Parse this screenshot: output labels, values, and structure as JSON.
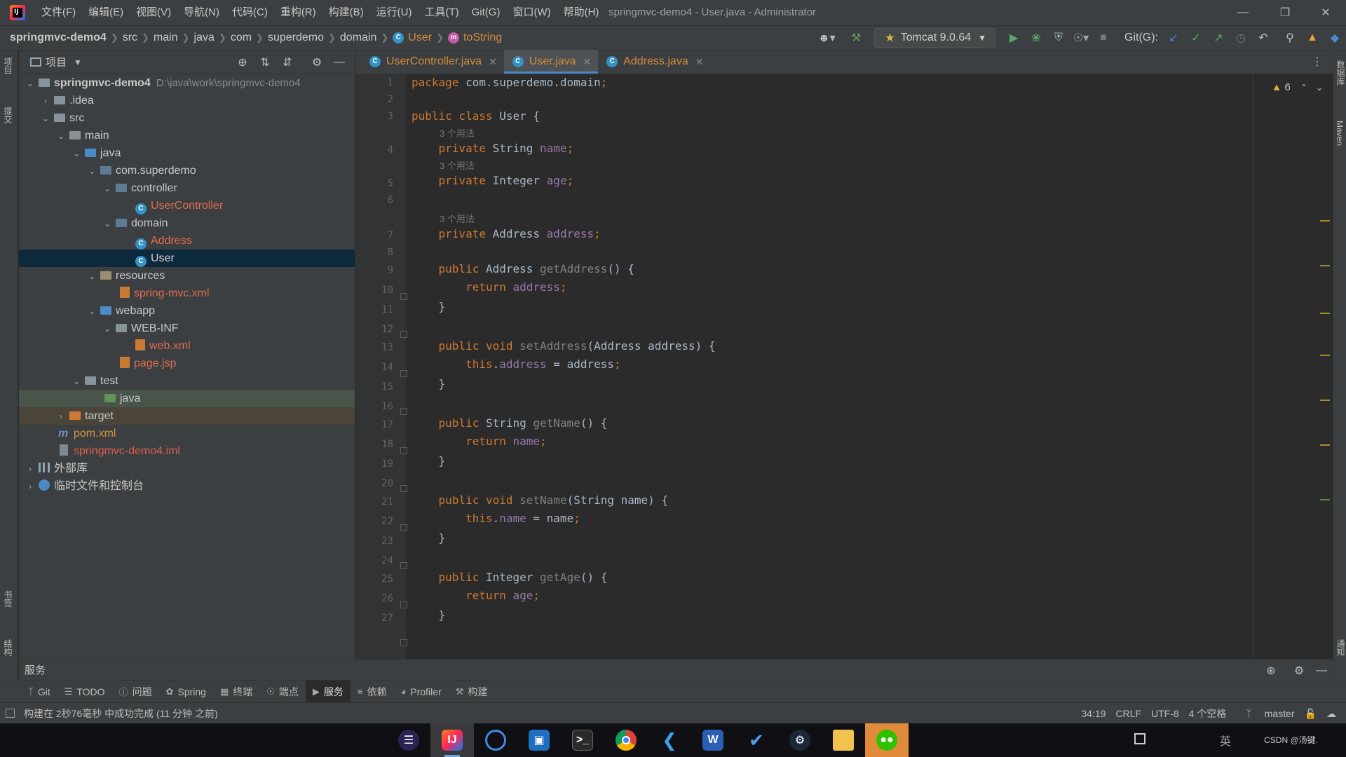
{
  "window": {
    "title": "springmvc-demo4 - User.java - Administrator",
    "menu": [
      "文件(F)",
      "编辑(E)",
      "视图(V)",
      "导航(N)",
      "代码(C)",
      "重构(R)",
      "构建(B)",
      "运行(U)",
      "工具(T)",
      "Git(G)",
      "窗口(W)",
      "帮助(H)"
    ]
  },
  "breadcrumb": [
    "springmvc-demo4",
    "src",
    "main",
    "java",
    "com",
    "superdemo",
    "domain",
    "User",
    "toString"
  ],
  "toolbar": {
    "run_config": "Tomcat 9.0.64",
    "git_label": "Git(G):"
  },
  "left_strip": {
    "top": "项目",
    "mid": "提交",
    "bookmarks": "书签",
    "structure": "结构"
  },
  "right_strip": {
    "db": "数据库",
    "maven": "Maven",
    "notify": "通知"
  },
  "project": {
    "header": "项目",
    "tree": [
      {
        "label": "springmvc-demo4",
        "path": "D:\\java\\work\\springmvc-demo4"
      },
      {
        "label": ".idea"
      },
      {
        "label": "src"
      },
      {
        "label": "main"
      },
      {
        "label": "java"
      },
      {
        "label": "com.superdemo"
      },
      {
        "label": "controller"
      },
      {
        "label": "UserController"
      },
      {
        "label": "domain"
      },
      {
        "label": "Address"
      },
      {
        "label": "User"
      },
      {
        "label": "resources"
      },
      {
        "label": "spring-mvc.xml"
      },
      {
        "label": "webapp"
      },
      {
        "label": "WEB-INF"
      },
      {
        "label": "web.xml"
      },
      {
        "label": "page.jsp"
      },
      {
        "label": "test"
      },
      {
        "label": "java"
      },
      {
        "label": "target"
      },
      {
        "label": "pom.xml"
      },
      {
        "label": "springmvc-demo4.iml"
      },
      {
        "label": "外部库"
      },
      {
        "label": "临时文件和控制台"
      }
    ]
  },
  "tabs": [
    {
      "label": "UserController.java"
    },
    {
      "label": "User.java"
    },
    {
      "label": "Address.java"
    }
  ],
  "editor": {
    "warning_count": "6",
    "usage_hint": "3 个用法",
    "line_numbers": [
      "1",
      "2",
      "3",
      "4",
      "5",
      "6",
      "7",
      "8",
      "9",
      "10",
      "11",
      "12",
      "13",
      "14",
      "15",
      "16",
      "17",
      "18",
      "19",
      "20",
      "21",
      "22",
      "23",
      "24",
      "25",
      "26",
      "27"
    ]
  },
  "services": {
    "title": "服务"
  },
  "tool_tabs": [
    {
      "label": "Git",
      "icon": "git-branch-icon"
    },
    {
      "label": "TODO",
      "icon": "list-icon"
    },
    {
      "label": "问题",
      "icon": "info-icon"
    },
    {
      "label": "Spring",
      "icon": "spring-leaf-icon"
    },
    {
      "label": "终端",
      "icon": "terminal-icon"
    },
    {
      "label": "端点",
      "icon": "endpoints-icon"
    },
    {
      "label": "服务",
      "icon": "play-circle-icon"
    },
    {
      "label": "依赖",
      "icon": "layers-icon"
    },
    {
      "label": "Profiler",
      "icon": "profiler-icon"
    },
    {
      "label": "构建",
      "icon": "hammer-icon"
    }
  ],
  "status": {
    "message": "构建在 2秒76毫秒 中成功完成 (11 分钟 之前)",
    "position": "34:19",
    "line_sep": "CRLF",
    "encoding": "UTF-8",
    "indent": "4 个空格",
    "branch": "master"
  },
  "taskbar": {
    "tray": "CSDN @汤键."
  }
}
